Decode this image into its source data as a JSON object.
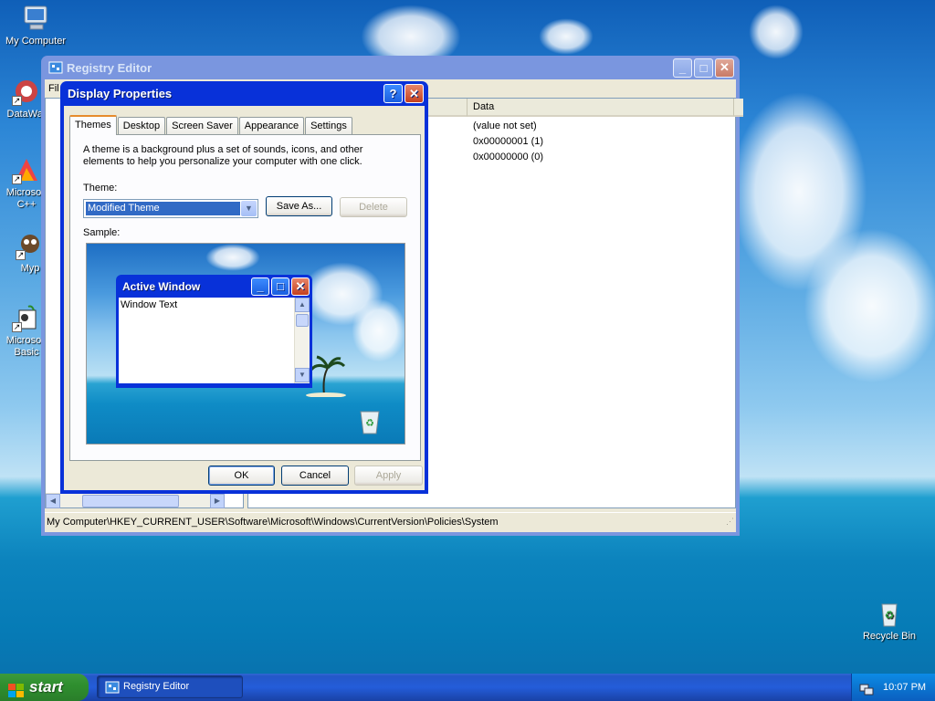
{
  "desktop": {
    "icons": [
      {
        "label": "My Computer"
      },
      {
        "label": "DataWar"
      },
      {
        "label": "Microsoft\nC++"
      },
      {
        "label": "Myp"
      },
      {
        "label": "Microsoft\nBasic"
      },
      {
        "label": "Recycle Bin"
      }
    ]
  },
  "registry": {
    "title": "Registry Editor",
    "menu_first": "Fil",
    "columns": {
      "data": "Data"
    },
    "rows": [
      {
        "data": "(value not set)"
      },
      {
        "data": "0x00000001 (1)"
      },
      {
        "data": "0x00000000 (0)"
      }
    ],
    "status": "My Computer\\HKEY_CURRENT_USER\\Software\\Microsoft\\Windows\\CurrentVersion\\Policies\\System",
    "buttons": {
      "minimize": "_",
      "maximize": "□",
      "close": "✕"
    }
  },
  "display": {
    "title": "Display Properties",
    "help": "?",
    "close": "✕",
    "tabs": [
      "Themes",
      "Desktop",
      "Screen Saver",
      "Appearance",
      "Settings"
    ],
    "description": "A theme is a background plus a set of sounds, icons, and other elements to help you personalize your computer with one click.",
    "theme_label": "Theme:",
    "theme_value": "Modified Theme",
    "save_as": "Save As...",
    "delete": "Delete",
    "sample_label": "Sample:",
    "sample_window": {
      "title": "Active Window",
      "text": "Window Text"
    },
    "ok": "OK",
    "cancel": "Cancel",
    "apply": "Apply"
  },
  "taskbar": {
    "start": "start",
    "task": "Registry Editor",
    "clock": "10:07 PM"
  }
}
